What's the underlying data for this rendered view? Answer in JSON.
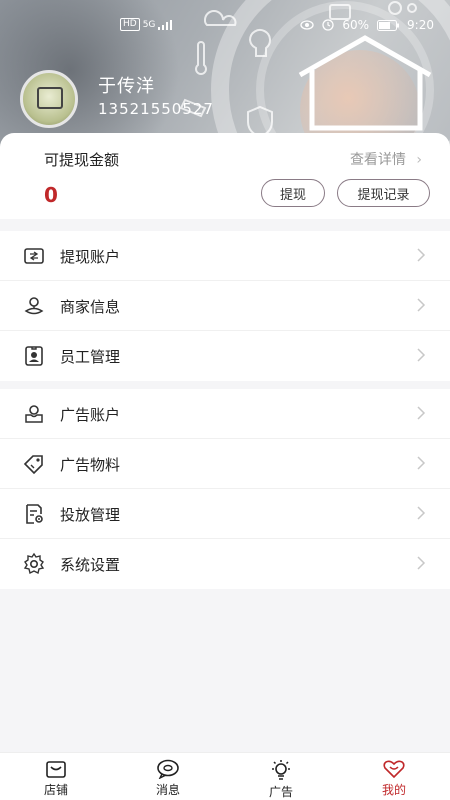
{
  "status": {
    "battery": "60%",
    "time": "9:20",
    "network": "HD",
    "signal": "5G"
  },
  "profile": {
    "name": "于传洋",
    "phone": "13521550527"
  },
  "balance": {
    "title": "可提现金额",
    "detail_link": "查看详情",
    "amount": "0",
    "withdraw_btn": "提现",
    "records_btn": "提现记录"
  },
  "menu_group1": [
    {
      "label": "提现账户",
      "icon": "wallet-icon"
    },
    {
      "label": "商家信息",
      "icon": "location-icon"
    },
    {
      "label": "员工管理",
      "icon": "badge-icon"
    }
  ],
  "menu_group2": [
    {
      "label": "广告账户",
      "icon": "user-account-icon"
    },
    {
      "label": "广告物料",
      "icon": "tag-icon"
    },
    {
      "label": "投放管理",
      "icon": "document-settings-icon"
    },
    {
      "label": "系统设置",
      "icon": "gear-icon"
    }
  ],
  "tabs": [
    {
      "label": "店铺",
      "icon": "shop-icon"
    },
    {
      "label": "消息",
      "icon": "message-icon"
    },
    {
      "label": "广告",
      "icon": "bulb-icon"
    },
    {
      "label": "我的",
      "icon": "heart-icon",
      "active": true
    }
  ],
  "colors": {
    "accent": "#c0282a",
    "background": "#f5f5f7"
  }
}
